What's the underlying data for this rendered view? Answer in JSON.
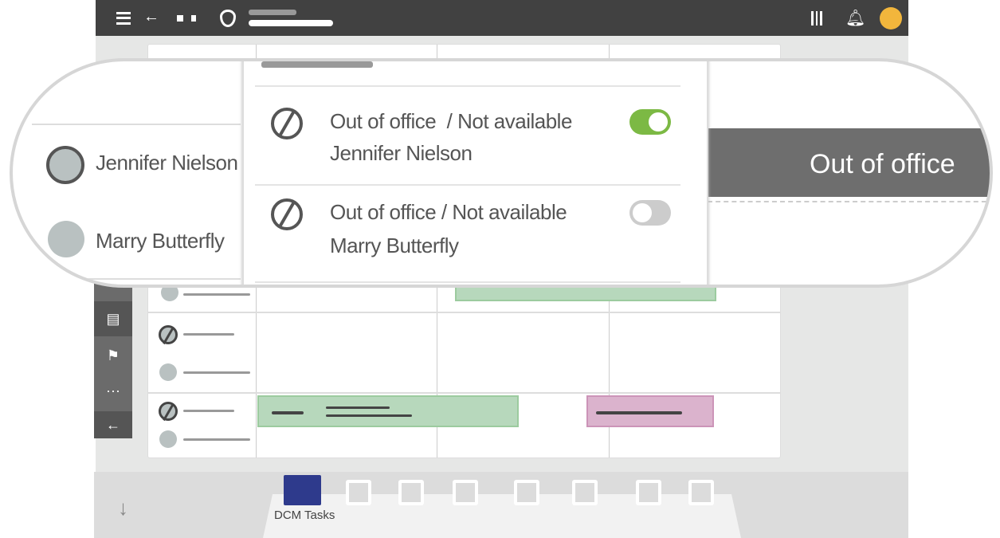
{
  "app": {
    "bottom_tab_label": "DCM Tasks",
    "accent": "#2e3a8c",
    "avatar_color": "#f2b63c"
  },
  "popover": {
    "items": [
      {
        "status": "Out of office  / Not available",
        "name": "Jennifer Nielson",
        "enabled": true
      },
      {
        "status": "Out of office / Not available",
        "name": "Marry Butterfly",
        "enabled": false
      }
    ]
  },
  "people": [
    {
      "name": "Jennifer Nielson",
      "out_of_office": true
    },
    {
      "name": "Marry Butterfly",
      "out_of_office": false
    }
  ],
  "timeline": {
    "banner": "Out of office",
    "banner_color": "#6e6e6e"
  },
  "colors": {
    "toggle_on": "#7cb944",
    "toggle_off": "#cccccc",
    "event_green": "#b7d8bc",
    "event_pink": "#dbb3cd"
  }
}
